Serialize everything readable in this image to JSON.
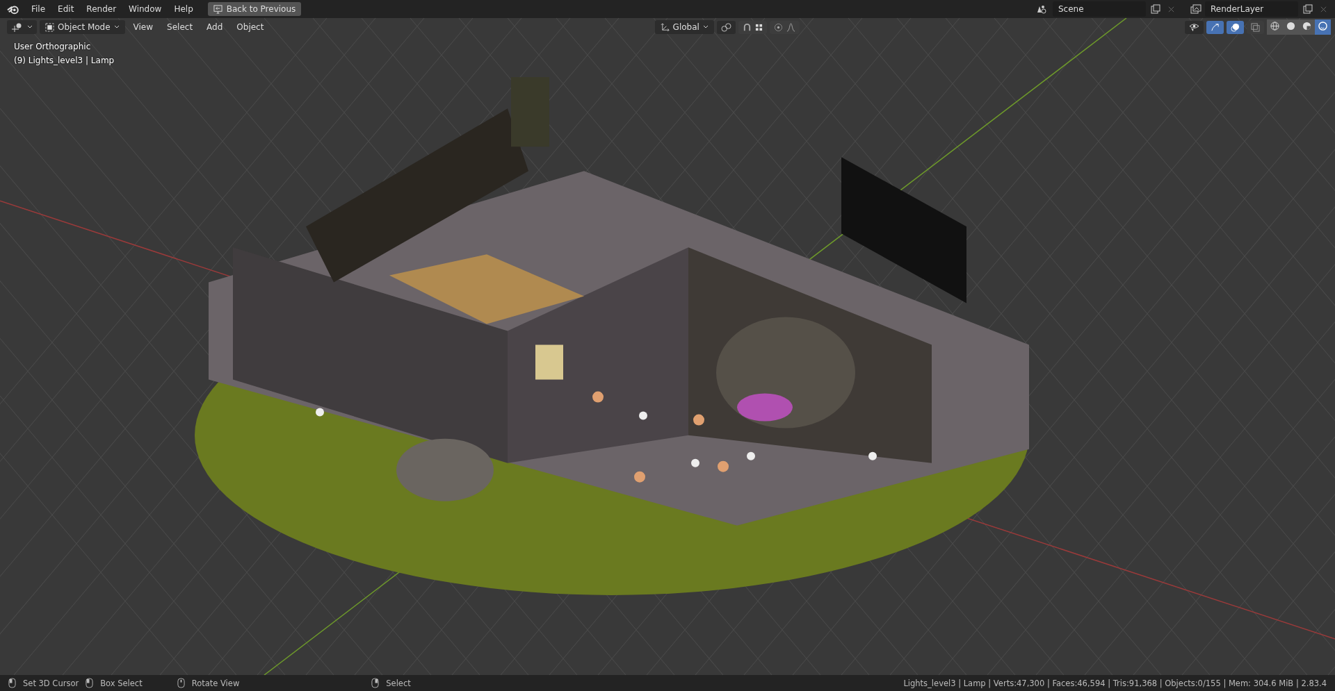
{
  "top_bar": {
    "menus": [
      "File",
      "Edit",
      "Render",
      "Window",
      "Help"
    ],
    "back_button": "Back to Previous",
    "scene": "Scene",
    "view_layer": "RenderLayer"
  },
  "viewport_header": {
    "mode": "Object Mode",
    "menus": [
      "View",
      "Select",
      "Add",
      "Object"
    ],
    "orientation": "Global",
    "toggles": {
      "snap": {
        "on": false
      },
      "proportional_edit": {
        "on": false
      },
      "gizmo": {
        "on": true
      },
      "overlays": {
        "on": true
      },
      "xray": {
        "on": false
      }
    },
    "shading_modes": [
      {
        "kind": "wireframe",
        "selected": false
      },
      {
        "kind": "solid",
        "selected": false
      },
      {
        "kind": "material",
        "selected": false
      },
      {
        "kind": "rendered",
        "selected": true
      }
    ]
  },
  "viewport": {
    "view_name": "User Orthographic",
    "object_info": "(9) Lights_level3 | Lamp"
  },
  "status_bar": {
    "hints": [
      {
        "kind": "left",
        "label": "Set 3D Cursor"
      },
      {
        "kind": "drag",
        "label": "Box Select"
      },
      {
        "kind": "middle",
        "label": "Rotate View"
      },
      {
        "kind": "right",
        "label": "Select"
      }
    ],
    "stats": "Lights_level3 | Lamp | Verts:47,300 | Faces:46,594 | Tris:91,368 | Objects:0/155 | Mem: 304.6 MiB | 2.83.4"
  }
}
